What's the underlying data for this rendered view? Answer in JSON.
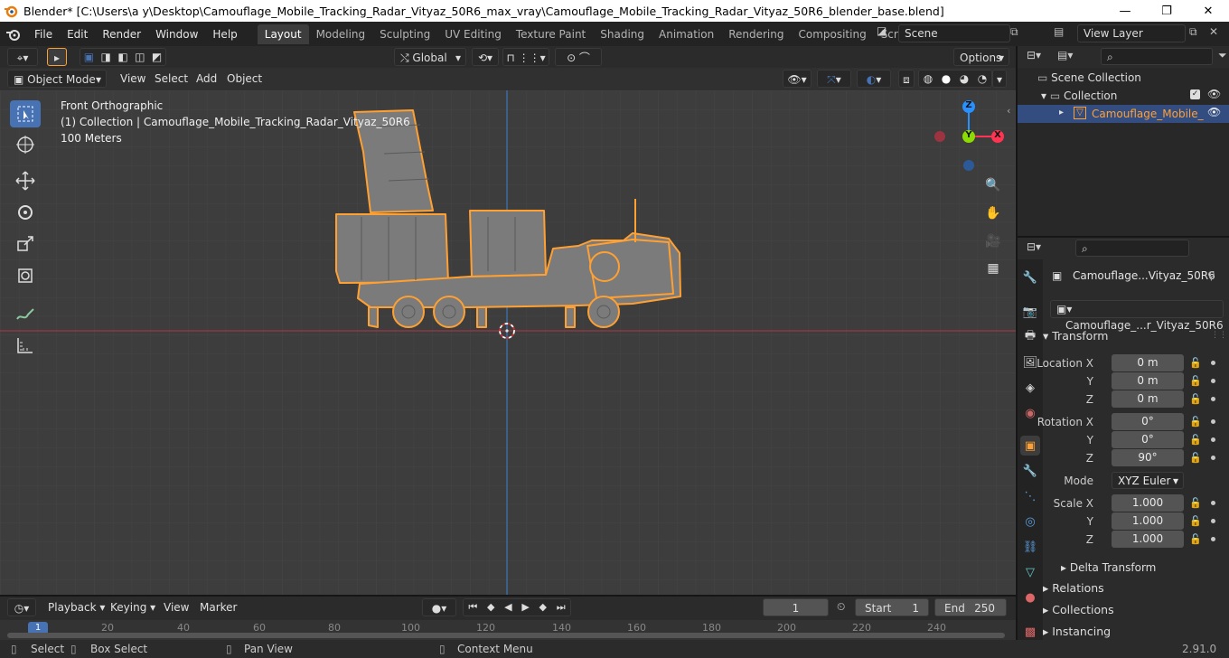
{
  "window": {
    "title": "Blender* [C:\\Users\\a y\\Desktop\\Camouflage_Mobile_Tracking_Radar_Vityaz_50R6_max_vray\\Camouflage_Mobile_Tracking_Radar_Vityaz_50R6_blender_base.blend]",
    "minimize": "—",
    "maximize": "❐",
    "close": "✕"
  },
  "menu": [
    "File",
    "Edit",
    "Render",
    "Window",
    "Help"
  ],
  "workspaces": [
    "Layout",
    "Modeling",
    "Sculpting",
    "UV Editing",
    "Texture Paint",
    "Shading",
    "Animation",
    "Rendering",
    "Compositing",
    "Scripting"
  ],
  "scene": {
    "label": "Scene",
    "view_layer": "View Layer"
  },
  "viewport_header": {
    "orientation": "Global",
    "options": "Options",
    "mode": "Object Mode",
    "menus": [
      "View",
      "Select",
      "Add",
      "Object"
    ]
  },
  "overlay_text": {
    "view": "Front Orthographic",
    "collection": "(1) Collection | Camouflage_Mobile_Tracking_Radar_Vityaz_50R6",
    "scale": "100 Meters"
  },
  "gizmo": {
    "z": "Z",
    "y": "Y",
    "x": "X"
  },
  "outliner": {
    "scene_collection": "Scene Collection",
    "collection": "Collection",
    "object": "Camouflage_Mobile_"
  },
  "properties": {
    "object_name": "Camouflage...Vityaz_50R6",
    "data_name": "Camouflage_...r_Vityaz_50R6",
    "transform_title": "Transform",
    "location": [
      {
        "label": "Location X",
        "value": "0 m"
      },
      {
        "label": "Y",
        "value": "0 m"
      },
      {
        "label": "Z",
        "value": "0 m"
      }
    ],
    "rotation": [
      {
        "label": "Rotation X",
        "value": "0°"
      },
      {
        "label": "Y",
        "value": "0°"
      },
      {
        "label": "Z",
        "value": "90°"
      }
    ],
    "mode_label": "Mode",
    "mode_value": "XYZ Euler",
    "scale": [
      {
        "label": "Scale X",
        "value": "1.000"
      },
      {
        "label": "Y",
        "value": "1.000"
      },
      {
        "label": "Z",
        "value": "1.000"
      }
    ],
    "delta": "Delta Transform",
    "sections": [
      "Relations",
      "Collections",
      "Instancing"
    ]
  },
  "timeline": {
    "menus": [
      "Playback",
      "Keying",
      "View",
      "Marker"
    ],
    "current_frame": "1",
    "start_label": "Start",
    "start": "1",
    "end_label": "End",
    "end": "250",
    "ruler": [
      "1",
      "20",
      "40",
      "60",
      "80",
      "100",
      "120",
      "140",
      "160",
      "180",
      "200",
      "220",
      "240"
    ]
  },
  "status": {
    "select": "Select",
    "box_select": "Box Select",
    "pan": "Pan View",
    "context": "Context Menu",
    "version": "2.91.0"
  },
  "colors": {
    "accent": "#4772b3",
    "selection": "#ffa033",
    "x_axis": "#ff3352",
    "y_axis": "#8bdc00",
    "z_axis": "#2890ff"
  }
}
